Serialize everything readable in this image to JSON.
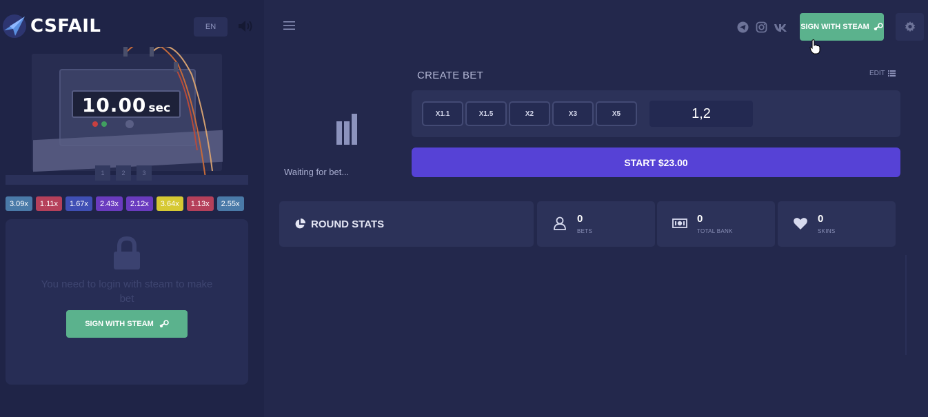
{
  "brand": {
    "part1": "CS",
    "part2": "FAIL"
  },
  "header": {
    "lang": "EN",
    "sign_in_label": "SIGN WITH STEAM"
  },
  "timer": {
    "value": "10.00",
    "unit": "sec"
  },
  "bomb_buttons": [
    "1",
    "2",
    "3"
  ],
  "history": [
    {
      "label": "3.09x",
      "color": "#4a7aa8"
    },
    {
      "label": "1.11x",
      "color": "#b5405a"
    },
    {
      "label": "1.67x",
      "color": "#3f4fb4"
    },
    {
      "label": "2.43x",
      "color": "#6a3bbf"
    },
    {
      "label": "2.12x",
      "color": "#6a3bbf"
    },
    {
      "label": "3.64x",
      "color": "#d6c933"
    },
    {
      "label": "1.13x",
      "color": "#b5405a"
    },
    {
      "label": "2.55x",
      "color": "#4a7aa8"
    }
  ],
  "login": {
    "message": "You need to login with steam to make bet",
    "button_label": "SIGN WITH STEAM"
  },
  "waiting": {
    "text": "Waiting for bet..."
  },
  "create_bet": {
    "title": "CREATE BET",
    "edit_label": "EDIT",
    "multipliers": [
      "X1.1",
      "X1.5",
      "X2",
      "X3",
      "X5"
    ],
    "value": "1,2",
    "start_label": "START $23.00"
  },
  "round_stats": {
    "title": "ROUND STATS",
    "bets": {
      "value": "0",
      "label": "BETS"
    },
    "bank": {
      "value": "0",
      "label": "TOTAL BANK"
    },
    "skins": {
      "value": "0",
      "label": "SKINS"
    }
  },
  "colors": {
    "accent_green": "#5bb28d",
    "accent_purple": "#5642d6",
    "panel": "#2c3259",
    "background": "#23284c"
  }
}
